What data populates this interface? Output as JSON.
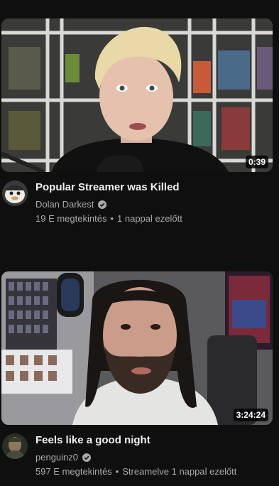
{
  "videos": [
    {
      "duration": "0:39",
      "title": "Popular Streamer was Killed",
      "channel": "Dolan Darkest",
      "verified_icon": "verified-check-icon",
      "views": "19 E megtekintés",
      "age": "1 nappal ezelőtt"
    },
    {
      "duration": "3:24:24",
      "title": "Feels like a good night",
      "channel": "penguinz0",
      "verified_icon": "verified-check-icon",
      "views": "597 E megtekintés",
      "age": "Streamelve 1 nappal ezelőtt"
    }
  ],
  "separator": "•"
}
